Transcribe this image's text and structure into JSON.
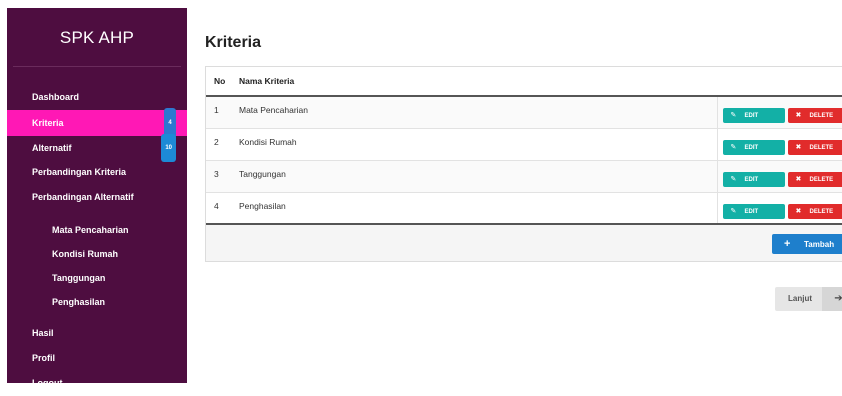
{
  "sidebar": {
    "brand": "SPK AHP",
    "items": [
      {
        "label": "Dashboard",
        "badge": null
      },
      {
        "label": "Kriteria",
        "badge": "4"
      },
      {
        "label": "Alternatif",
        "badge": "10"
      },
      {
        "label": "Perbandingan Kriteria",
        "badge": null
      },
      {
        "label": "Perbandingan Alternatif",
        "badge": null
      }
    ],
    "subitems": [
      {
        "label": "Mata Pencaharian"
      },
      {
        "label": "Kondisi Rumah"
      },
      {
        "label": "Tanggungan"
      },
      {
        "label": "Penghasilan"
      }
    ],
    "bottom_items": [
      {
        "label": "Hasil"
      },
      {
        "label": "Profil"
      },
      {
        "label": "Logout"
      }
    ]
  },
  "page": {
    "title": "Kriteria"
  },
  "table": {
    "headers": [
      "No",
      "Nama Kriteria"
    ],
    "rows": [
      {
        "no": "1",
        "name": "Mata Pencaharian"
      },
      {
        "no": "2",
        "name": "Kondisi Rumah"
      },
      {
        "no": "3",
        "name": "Tanggungan"
      },
      {
        "no": "4",
        "name": "Penghasilan"
      }
    ],
    "edit_label": "EDIT",
    "delete_label": "DELETE"
  },
  "buttons": {
    "tambah": "Tambah",
    "lanjut": "Lanjut"
  },
  "icons": {
    "edit": "pencil-square-icon",
    "delete": "x-icon",
    "add": "plus-icon",
    "next": "arrow-right-icon"
  },
  "colors": {
    "sidebar_bg": "#4e0d40",
    "active_item": "#ff18b5",
    "edit": "#13b0a6",
    "delete": "#e12b2b",
    "tambah": "#1e7fcc",
    "badge": "#1d8ad6"
  }
}
